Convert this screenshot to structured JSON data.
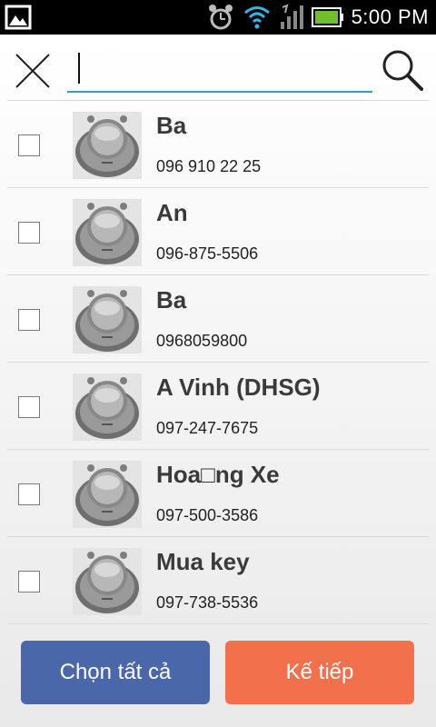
{
  "status_bar": {
    "time": "5:00 PM",
    "icons": [
      "image-icon",
      "alarm-icon",
      "wifi-icon",
      "signal-icon",
      "battery-icon"
    ]
  },
  "search": {
    "placeholder": "",
    "value": ""
  },
  "contacts": [
    {
      "name": "Ba",
      "phone": "096 910 22 25"
    },
    {
      "name": "An",
      "phone": "096-875-5506"
    },
    {
      "name": "Ba",
      "phone": "0968059800"
    },
    {
      "name": "A Vinh (DHSG)",
      "phone": "097-247-7675"
    },
    {
      "name": "Hoa□ng Xe",
      "phone": "097-500-3586"
    },
    {
      "name": "Mua key",
      "phone": "097-738-5536"
    }
  ],
  "buttons": {
    "select_all": "Chọn tất cả",
    "next": "Kế tiếp"
  },
  "colors": {
    "accent_blue": "#4a67a9",
    "accent_orange": "#f3704d",
    "search_underline": "#2a9fd6"
  }
}
